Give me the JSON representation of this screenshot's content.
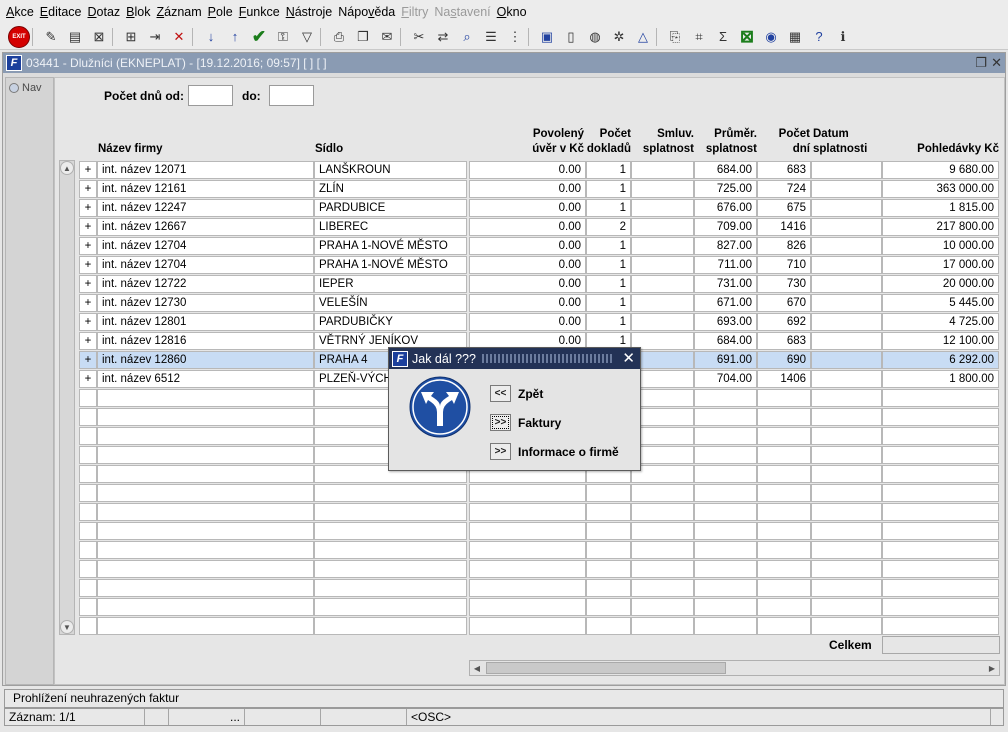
{
  "menu": [
    {
      "pre": "",
      "u": "A",
      "post": "kce",
      "disabled": false
    },
    {
      "pre": "",
      "u": "E",
      "post": "ditace",
      "disabled": false
    },
    {
      "pre": "",
      "u": "D",
      "post": "otaz",
      "disabled": false
    },
    {
      "pre": "",
      "u": "B",
      "post": "lok",
      "disabled": false
    },
    {
      "pre": "",
      "u": "Z",
      "post": "áznam",
      "disabled": false
    },
    {
      "pre": "",
      "u": "P",
      "post": "ole",
      "disabled": false
    },
    {
      "pre": "",
      "u": "F",
      "post": "unkce",
      "disabled": false
    },
    {
      "pre": "",
      "u": "N",
      "post": "ástroje",
      "disabled": false
    },
    {
      "pre": "Nápo",
      "u": "v",
      "post": "ěda",
      "disabled": false
    },
    {
      "pre": "",
      "u": "F",
      "post": "iltry",
      "disabled": true
    },
    {
      "pre": "Na",
      "u": "s",
      "post": "tavení",
      "disabled": true
    },
    {
      "pre": "",
      "u": "O",
      "post": "kno",
      "disabled": false
    }
  ],
  "toolbar": {
    "exit_label": "EXIT",
    "icons": [
      "insert-record-icon",
      "save-icon",
      "delete-record-icon",
      "sort-asc-icon",
      "sort-desc-icon",
      "confirm-icon",
      "key-icon",
      "filter-icon",
      "print-icon",
      "copy-icon",
      "mail-icon",
      "cut-icon",
      "transfer-icon",
      "search-icon",
      "list-icon",
      "tree-icon",
      "document-icon",
      "page-icon",
      "globe-icon",
      "settings-icon",
      "chart-icon",
      "report-icon",
      "query-icon",
      "sum-icon",
      "excel-icon",
      "web-icon",
      "calculator-icon",
      "help-icon",
      "info-icon"
    ]
  },
  "window": {
    "title": "03441 - Dlužníci (EKNEPLAT) - [19.12.2016; 09:57]  [ ]  [ ]",
    "nav_label": "Nav"
  },
  "filter": {
    "days_from_label": "Počet dnů od:",
    "days_to_label": "do:",
    "days_from_value": "",
    "days_to_value": ""
  },
  "table": {
    "headers": {
      "name": "Název firmy",
      "seat": "Sídlo",
      "credit_l1": "Povolený",
      "credit_l2": "úvěr v Kč",
      "docs_l1": "Počet",
      "docs_l2": "dokladů",
      "contract_l1": "Smluv.",
      "contract_l2": "splatnost",
      "avg_l1": "Průměr.",
      "avg_l2": "splatnost",
      "days_l1": "Počet",
      "days_l2": "dní",
      "due_l1": "Datum",
      "due_l2": "splatnosti",
      "claims": "Pohledávky Kč"
    },
    "rows": [
      {
        "plus": "+",
        "name": "int. název 12071",
        "seat": "LANŠKROUN",
        "credit": "0.00",
        "docs": "1",
        "contract": "",
        "avg": "684.00",
        "days": "683",
        "due": "",
        "claims": "9 680.00"
      },
      {
        "plus": "+",
        "name": "int. název 12161",
        "seat": "ZLÍN",
        "credit": "0.00",
        "docs": "1",
        "contract": "",
        "avg": "725.00",
        "days": "724",
        "due": "",
        "claims": "363 000.00"
      },
      {
        "plus": "+",
        "name": "int. název 12247",
        "seat": "PARDUBICE",
        "credit": "0.00",
        "docs": "1",
        "contract": "",
        "avg": "676.00",
        "days": "675",
        "due": "",
        "claims": "1 815.00"
      },
      {
        "plus": "+",
        "name": "int. název 12667",
        "seat": "LIBEREC",
        "credit": "0.00",
        "docs": "2",
        "contract": "",
        "avg": "709.00",
        "days": "1416",
        "due": "",
        "claims": "217 800.00"
      },
      {
        "plus": "+",
        "name": "int. název 12704",
        "seat": "PRAHA 1-NOVÉ MĚSTO",
        "credit": "0.00",
        "docs": "1",
        "contract": "",
        "avg": "827.00",
        "days": "826",
        "due": "",
        "claims": "10 000.00"
      },
      {
        "plus": "+",
        "name": "int. název 12704",
        "seat": "PRAHA 1-NOVÉ MĚSTO",
        "credit": "0.00",
        "docs": "1",
        "contract": "",
        "avg": "711.00",
        "days": "710",
        "due": "",
        "claims": "17 000.00"
      },
      {
        "plus": "+",
        "name": "int. název 12722",
        "seat": "IEPER",
        "credit": "0.00",
        "docs": "1",
        "contract": "",
        "avg": "731.00",
        "days": "730",
        "due": "",
        "claims": "20 000.00"
      },
      {
        "plus": "+",
        "name": "int. název 12730",
        "seat": "VELEŠÍN",
        "credit": "0.00",
        "docs": "1",
        "contract": "",
        "avg": "671.00",
        "days": "670",
        "due": "",
        "claims": "5 445.00"
      },
      {
        "plus": "+",
        "name": "int. název 12801",
        "seat": "PARDUBIČKY",
        "credit": "0.00",
        "docs": "1",
        "contract": "",
        "avg": "693.00",
        "days": "692",
        "due": "",
        "claims": "4 725.00"
      },
      {
        "plus": "+",
        "name": "int. název 12816",
        "seat": "VĚTRNÝ JENÍKOV",
        "credit": "0.00",
        "docs": "1",
        "contract": "",
        "avg": "684.00",
        "days": "683",
        "due": "",
        "claims": "12 100.00"
      },
      {
        "plus": "+",
        "name": "int. název 12860",
        "seat": "PRAHA 4",
        "credit": "0.00",
        "docs": "1",
        "contract": "",
        "avg": "691.00",
        "days": "690",
        "due": "",
        "claims": "6 292.00",
        "selected": true
      },
      {
        "plus": "+",
        "name": "int. název 6512",
        "seat": "PLZEŇ-VÝCHOD",
        "credit": "0.00",
        "docs": "1",
        "contract": "",
        "avg": "704.00",
        "days": "1406",
        "due": "",
        "claims": "1 800.00"
      }
    ],
    "empty_rows": 13,
    "total_label": "Celkem",
    "total_value": ""
  },
  "dialog": {
    "title": "Jak dál ???",
    "icon": "direction-arrows-icon",
    "buttons": [
      {
        "symbol": "<<",
        "label": "Zpět",
        "focused": false
      },
      {
        "symbol": ">>",
        "label": "Faktury",
        "focused": true
      },
      {
        "symbol": ">>",
        "label": "Informace o firmě",
        "focused": false
      }
    ]
  },
  "status": {
    "message": "Prohlížení neuhrazených faktur",
    "record": "Záznam: 1/1",
    "ellipsis": "...",
    "mode": "<OSC>"
  },
  "colors": {
    "selected_row": "#c8dcf4",
    "dialog_title": "#233256",
    "window_title": "#8a9bb3",
    "exit_red": "#d40000"
  }
}
